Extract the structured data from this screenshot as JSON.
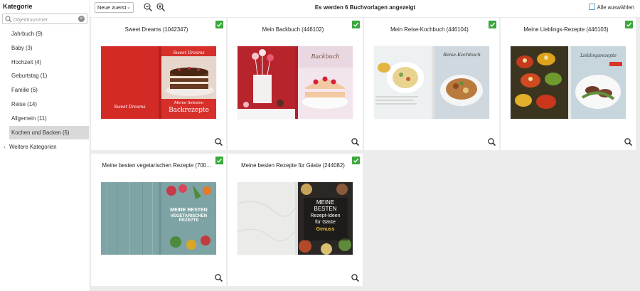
{
  "sidebar": {
    "title": "Kategorie",
    "search_placeholder": "Objektnummer",
    "clear_symbol": "×",
    "categories": [
      {
        "label": "Jahrbuch (9)"
      },
      {
        "label": "Baby (3)"
      },
      {
        "label": "Hochzeit (4)"
      },
      {
        "label": "Geburtstag (1)"
      },
      {
        "label": "Familie (6)"
      },
      {
        "label": "Reise (14)"
      },
      {
        "label": "Allgemein (11)"
      },
      {
        "label": "Kochen und Backen (6)",
        "active": true
      }
    ],
    "more_label": "Weitere Kategorien",
    "more_chevron": "›"
  },
  "toolbar": {
    "sort_value": "Neue zuerst",
    "sort_arrow": "⌄",
    "status": "Es werden 6 Buchvorlagen angezeigt",
    "select_all": "Alle auswählen"
  },
  "cards": [
    {
      "title": "Sweet Dreams (1042347)",
      "cover_line1": "Meine liebsten",
      "cover_line2": "Backrezepte",
      "back_text": "Sweet Dreams",
      "front_text": "Sweet Dreams"
    },
    {
      "title": "Mein Backbuch (446102)",
      "cover_title": "Backbuch"
    },
    {
      "title": "Mein Reise-Kochbuch (446104)",
      "cover_title": "Reise-Kochbuch"
    },
    {
      "title": "Meine Lieblings-Rezepte (446103)",
      "cover_title": "Lieblingsrezepte"
    },
    {
      "title": "Meine besten vegetarischen Rezepte (700...",
      "cover_line1": "MEINE BESTEN",
      "cover_line2": "VEGETARISCHEN REZEPTE"
    },
    {
      "title": "Meine besten Rezepte für Gäste (244082)",
      "cover_line1": "MEINE",
      "cover_line2": "BESTEN",
      "cover_line3": "Rezept-Ideen",
      "cover_line4": "für Gäste",
      "cover_line5": "Genuss"
    }
  ],
  "colors": {
    "check_green": "#3aa83a",
    "active_bg": "#d9d9d9",
    "grid_bg": "#ececec"
  }
}
